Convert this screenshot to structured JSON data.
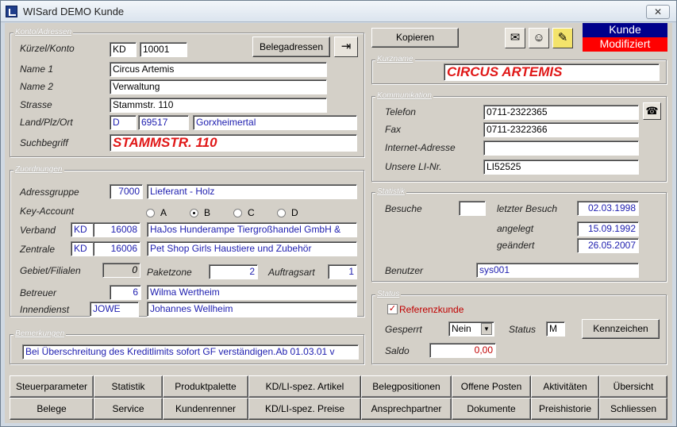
{
  "window": {
    "title": "WISard DEMO Kunde",
    "close_glyph": "✕"
  },
  "konto": {
    "group_title": "Konto/Adressen",
    "kuerzel_label": "Kürzel/Konto",
    "kuerzel": "KD",
    "konto": "10001",
    "belegadressen_btn": "Belegadressen",
    "name1_label": "Name 1",
    "name1": "Circus Artemis",
    "name2_label": "Name 2",
    "name2": "Verwaltung",
    "strasse_label": "Strasse",
    "strasse": "Stammstr. 110",
    "ort_label": "Land/Plz/Ort",
    "land": "D",
    "plz": "69517",
    "ort": "Gorxheimertal",
    "such_label": "Suchbegriff",
    "suchbegriff": "STAMMSTR. 110"
  },
  "top": {
    "kopieren_btn": "Kopieren",
    "status_line1": "Kunde",
    "status_line2": "Modifiziert",
    "status_color1": "#00008b",
    "status_color2": "#ff0000"
  },
  "kurzname": {
    "group_title": "Kurzname",
    "value": "CIRCUS ARTEMIS"
  },
  "kommunikation": {
    "group_title": "Kommunikation",
    "telefon_label": "Telefon",
    "telefon": "0711-2322365",
    "fax_label": "Fax",
    "fax": "0711-2322366",
    "internet_label": "Internet-Adresse",
    "internet": "",
    "linr_label": "Unsere LI-Nr.",
    "linr": "LI52525"
  },
  "zuordnungen": {
    "group_title": "Zuordnungen",
    "adressgruppe_label": "Adressgruppe",
    "adressgruppe_code": "7000",
    "adressgruppe_text": "Lieferant - Holz",
    "keyaccount_label": "Key-Account",
    "key_options": [
      "A",
      "B",
      "C",
      "D"
    ],
    "key_selected": "B",
    "verband_label": "Verband",
    "verband_typ": "KD",
    "verband_nr": "16008",
    "verband_name": "HaJos Hunderampe Tiergroßhandel GmbH &",
    "zentrale_label": "Zentrale",
    "zentrale_typ": "KD",
    "zentrale_nr": "16006",
    "zentrale_name": "Pet Shop Girls Haustiere und Zubehör",
    "gebiet_label": "Gebiet/Filialen",
    "gebiet": "0",
    "paketzone_label": "Paketzone",
    "paketzone": "2",
    "auftragsart_label": "Auftragsart",
    "auftragsart": "1",
    "betreuer_label": "Betreuer",
    "betreuer_nr": "6",
    "betreuer_name": "Wilma Wertheim",
    "innendienst_label": "Innendienst",
    "innendienst_code": "JOWE",
    "innendienst_name": "Johannes Wellheim"
  },
  "statistik": {
    "group_title": "Statistik",
    "besuche_label": "Besuche",
    "besuche": "",
    "letzter_label": "letzter Besuch",
    "letzter": "02.03.1998",
    "angelegt_label": "angelegt",
    "angelegt": "15.09.1992",
    "geaendert_label": "geändert",
    "geaendert": "26.05.2007",
    "benutzer_label": "Benutzer",
    "benutzer": "sys001"
  },
  "bemerkungen": {
    "group_title": "Bemerkungen",
    "text": "Bei Überschreitung des Kreditlimits sofort GF verständigen.Ab 01.03.01 v"
  },
  "status": {
    "group_title": "Status",
    "referenz_label": "Referenzkunde",
    "referenz_checked": true,
    "gesperrt_label": "Gesperrt",
    "gesperrt": "Nein",
    "status_label": "Status",
    "status": "M",
    "kennzeichen_btn": "Kennzeichen",
    "saldo_label": "Saldo",
    "saldo": "0,00"
  },
  "buttons_row1": [
    "Steuerparameter",
    "Statistik",
    "Produktpalette",
    "KD/LI-spez. Artikel",
    "Belegpositionen",
    "Offene Posten",
    "Aktivitäten",
    "Übersicht"
  ],
  "buttons_row2": [
    "Belege",
    "Service",
    "Kundenrenner",
    "KD/LI-spez. Preise",
    "Ansprechpartner",
    "Dokumente",
    "Preishistorie",
    "Schliessen"
  ]
}
